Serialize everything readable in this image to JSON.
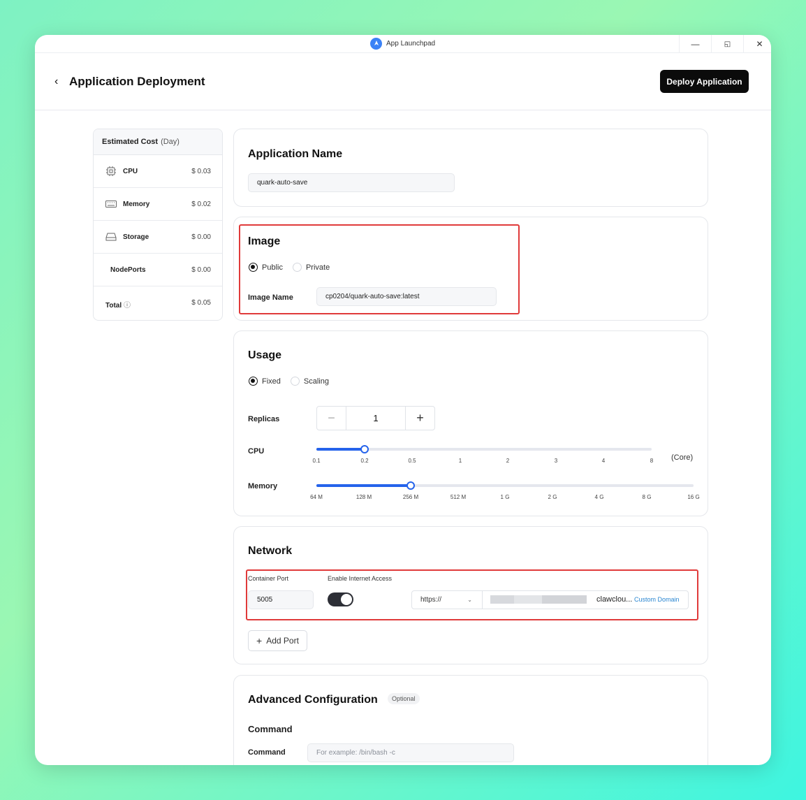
{
  "window": {
    "title": "App Launchpad"
  },
  "header": {
    "title": "Application Deployment",
    "deploy_label": "Deploy Application"
  },
  "cost": {
    "title": "Estimated Cost",
    "unit": "(Day)",
    "rows": [
      {
        "label": "CPU",
        "value": "$ 0.03",
        "icon": "cpu-icon"
      },
      {
        "label": "Memory",
        "value": "$ 0.02",
        "icon": "memory-icon"
      },
      {
        "label": "Storage",
        "value": "$ 0.00",
        "icon": "storage-icon"
      },
      {
        "label": "NodePorts",
        "value": "$ 0.00"
      },
      {
        "label": "Total",
        "value": "$ 0.05",
        "icon": "help-icon"
      }
    ]
  },
  "app_name": {
    "title": "Application Name",
    "value": "quark-auto-save"
  },
  "image": {
    "title": "Image",
    "options": [
      "Public",
      "Private"
    ],
    "selected": "Public",
    "name_label": "Image Name",
    "name_value": "cp0204/quark-auto-save:latest"
  },
  "usage": {
    "title": "Usage",
    "options": [
      "Fixed",
      "Scaling"
    ],
    "selected": "Fixed",
    "replicas_label": "Replicas",
    "replicas_value": "1",
    "cpu_label": "CPU",
    "cpu_ticks": [
      "0.1",
      "0.2",
      "0.5",
      "1",
      "2",
      "3",
      "4",
      "8"
    ],
    "cpu_unit": "(Core)",
    "cpu_value": "0.2",
    "memory_label": "Memory",
    "memory_ticks": [
      "64 M",
      "128 M",
      "256 M",
      "512 M",
      "1 G",
      "2 G",
      "4 G",
      "8 G",
      "16 G"
    ],
    "memory_value": "256 M"
  },
  "network": {
    "title": "Network",
    "port_label": "Container Port",
    "port_value": "5005",
    "internet_label": "Enable Internet Access",
    "internet_enabled": true,
    "protocol": "https://",
    "domain_suffix": "clawclou...",
    "custom_domain": "Custom Domain",
    "add_port": "Add Port"
  },
  "advanced": {
    "title": "Advanced Configuration",
    "optional": "Optional",
    "command_section": "Command",
    "command_label": "Command",
    "command_placeholder": "For example: /bin/bash -c"
  },
  "colors": {
    "accent": "#2563eb",
    "highlight": "#e03a3a",
    "primary_button": "#0b0b0b"
  }
}
